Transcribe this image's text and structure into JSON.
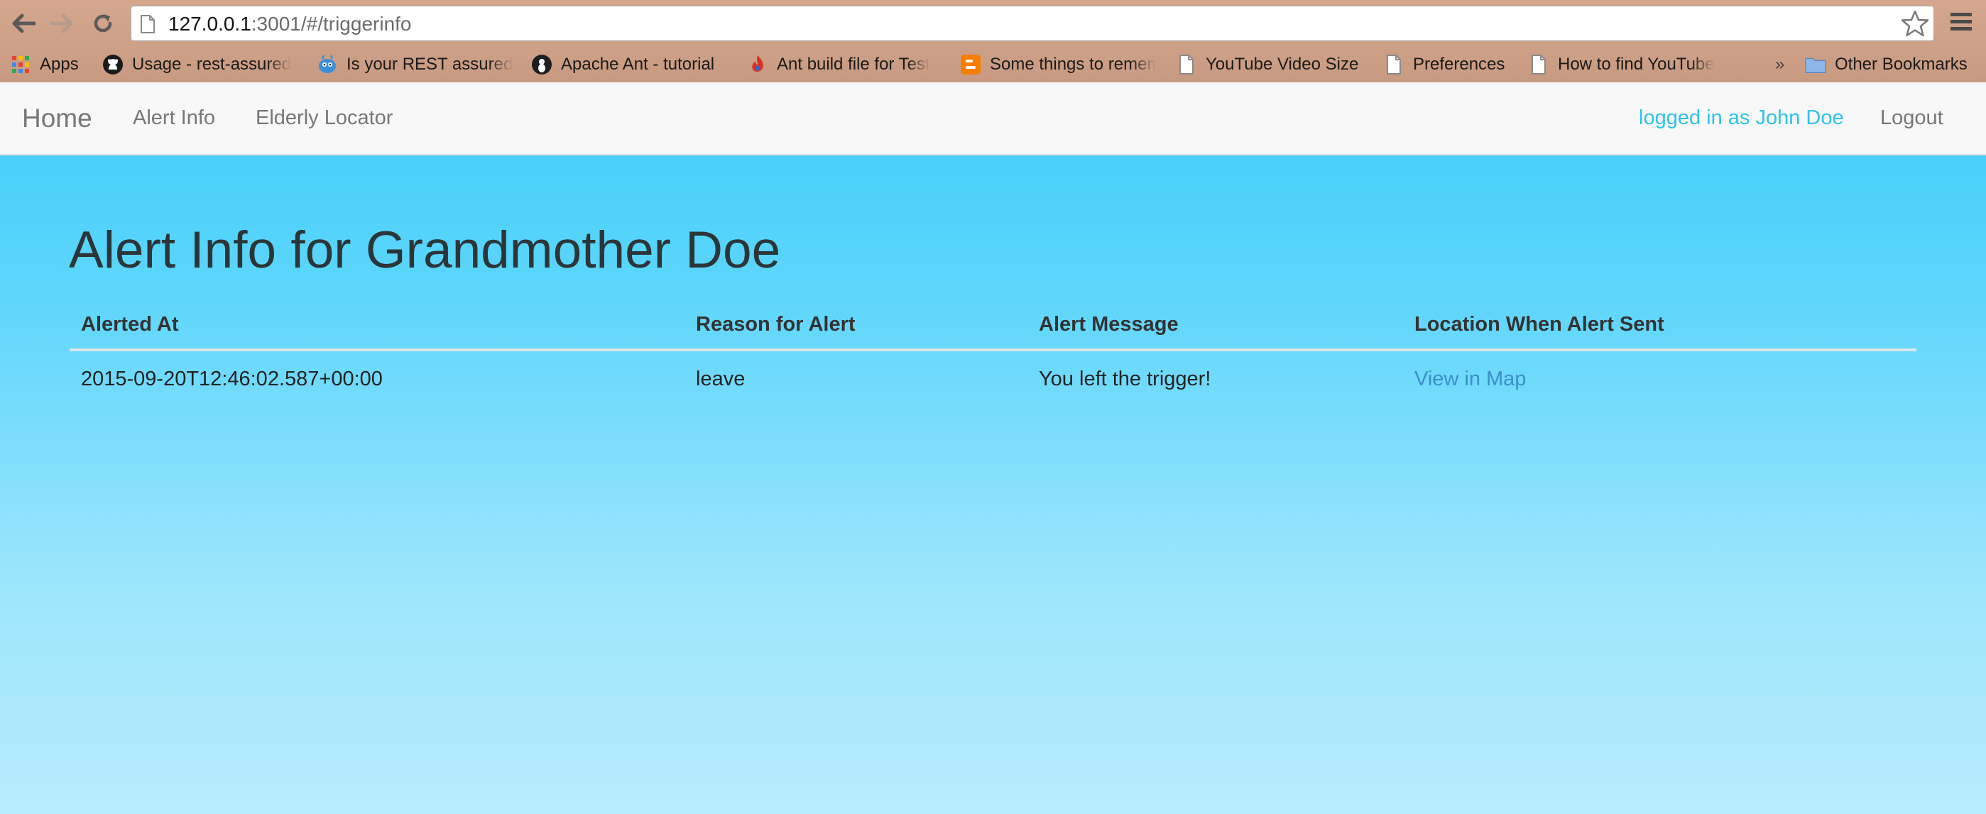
{
  "browser": {
    "url_host": "127.0.0.1",
    "url_rest": ":3001/#/triggerinfo",
    "bookmarks": [
      {
        "label": "Apps",
        "icon": "apps-grid-icon"
      },
      {
        "label": "Usage - rest-assured",
        "icon": "github-icon"
      },
      {
        "label": "Is your REST assured",
        "icon": "blue-creature-icon"
      },
      {
        "label": "Apache Ant - tutorial",
        "icon": "ant-icon"
      },
      {
        "label": "Ant build file for Test",
        "icon": "flame-icon"
      },
      {
        "label": "Some things to remember",
        "icon": "blogger-icon"
      },
      {
        "label": "YouTube Video Size",
        "icon": "page-icon"
      },
      {
        "label": "Preferences",
        "icon": "page-icon"
      },
      {
        "label": "How to find YouTube",
        "icon": "page-icon"
      }
    ],
    "overflow_label": "»",
    "other_bookmarks_label": "Other Bookmarks"
  },
  "navbar": {
    "brand": "Home",
    "links": [
      "Alert Info",
      "Elderly Locator"
    ],
    "user_text": "logged in as John Doe",
    "logout": "Logout"
  },
  "main": {
    "title": "Alert Info for Grandmother Doe",
    "table": {
      "headers": [
        "Alerted At",
        "Reason for Alert",
        "Alert Message",
        "Location When Alert Sent"
      ],
      "rows": [
        {
          "alerted_at": "2015-09-20T12:46:02.587+00:00",
          "reason": "leave",
          "message": "You left the trigger!",
          "location_link": "View in Map"
        }
      ]
    }
  },
  "colors": {
    "page_gradient_top": "#3ccdfb",
    "page_gradient_bottom": "#b7ecfd",
    "user_link": "#2cc4e8",
    "table_link": "#3d8ecb"
  }
}
